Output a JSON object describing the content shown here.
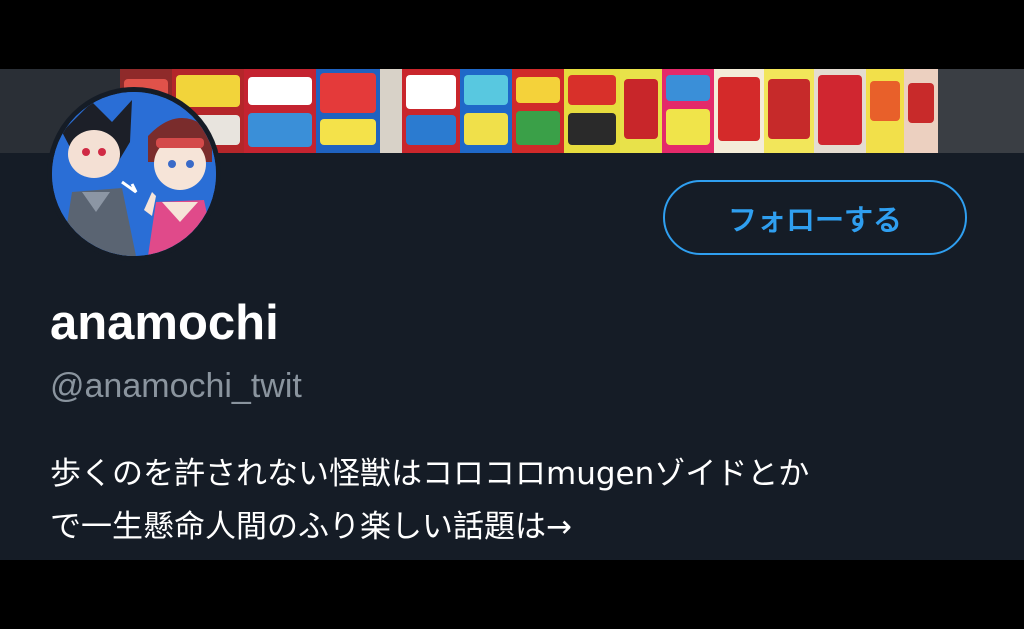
{
  "profile": {
    "display_name": "anamochi",
    "handle": "@anamochi_twit",
    "bio": "歩くのを許されない怪獣はコロコロmugenゾイドとか\nで一生懸命人間のふり楽しい話題は→"
  },
  "actions": {
    "follow_label": "フォローする"
  },
  "colors": {
    "accent": "#2f9ff0",
    "card_background": "#151c26",
    "handle_text": "#8a949e"
  }
}
